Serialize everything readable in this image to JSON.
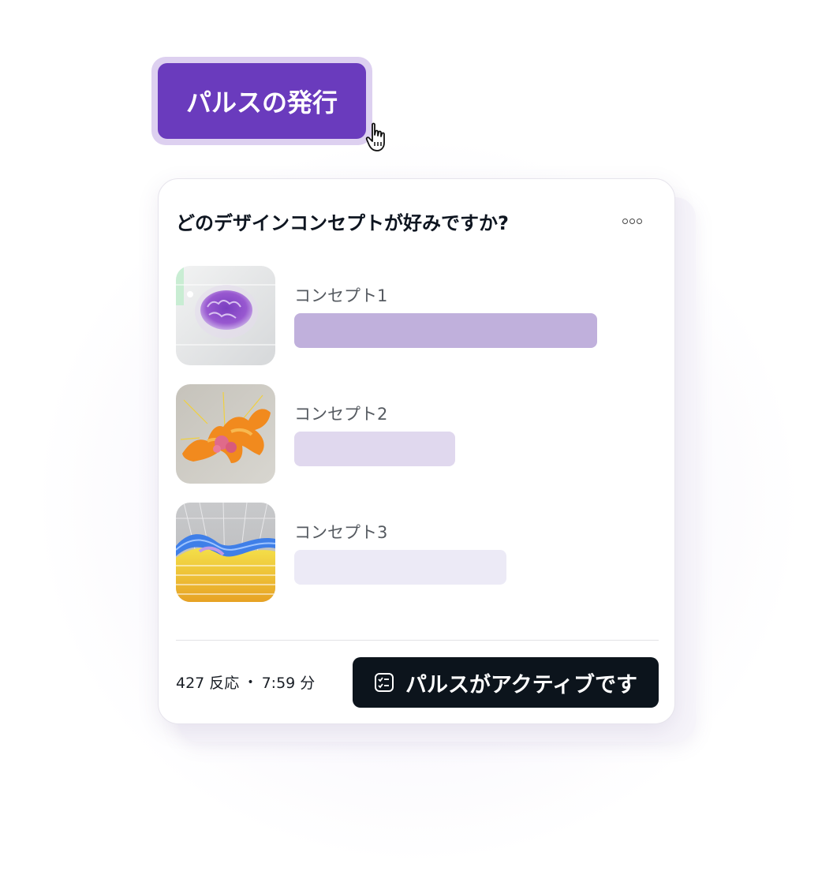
{
  "publish_button": {
    "label": "パルスの発行"
  },
  "poll": {
    "question": "どのデザインコンセプトが好みですか?",
    "options": [
      {
        "label": "コンセプト1",
        "bar_fraction": 1.0,
        "color": "#c0b0dc"
      },
      {
        "label": "コンセプト2",
        "bar_fraction": 0.53,
        "color": "#e0d8ee"
      },
      {
        "label": "コンセプト3",
        "bar_fraction": 0.7,
        "color": "#eceaf6"
      }
    ]
  },
  "footer": {
    "responses": "427 反応",
    "separator": "•",
    "time": "7:59 分",
    "status_button": "パルスがアクティブです"
  },
  "colors": {
    "accent": "#6a3bbd",
    "dark_button": "#0c141c"
  },
  "icons": {
    "menu": "more-options-icon",
    "status": "checklist-icon",
    "cursor": "hand-pointer-icon"
  }
}
